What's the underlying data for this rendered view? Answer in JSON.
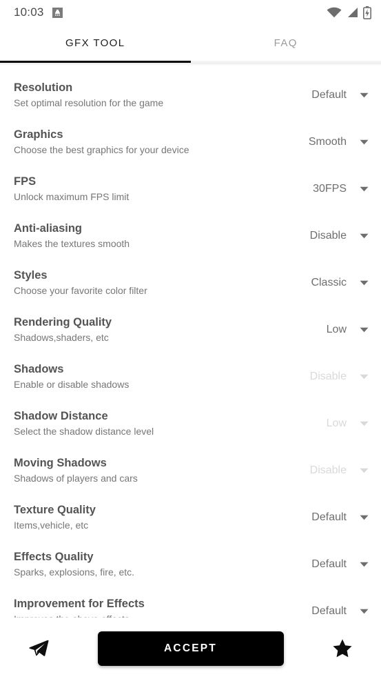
{
  "statusbar": {
    "time": "10:03",
    "notification_icon": "app-notification-icon",
    "wifi_icon": "wifi-icon",
    "signal_icon": "cellular-signal-icon",
    "battery_icon": "battery-charging-icon"
  },
  "tabs": [
    {
      "label": "GFX TOOL",
      "active": true
    },
    {
      "label": "FAQ",
      "active": false
    }
  ],
  "settings": [
    {
      "title": "Resolution",
      "subtitle": "Set optimal resolution for the game",
      "value": "Default",
      "disabled": false
    },
    {
      "title": "Graphics",
      "subtitle": "Choose the best graphics for your device",
      "value": "Smooth",
      "disabled": false
    },
    {
      "title": "FPS",
      "subtitle": "Unlock maximum FPS limit",
      "value": "30FPS",
      "disabled": false
    },
    {
      "title": "Anti-aliasing",
      "subtitle": "Makes the textures smooth",
      "value": "Disable",
      "disabled": false
    },
    {
      "title": "Styles",
      "subtitle": "Choose your favorite color filter",
      "value": "Classic",
      "disabled": false
    },
    {
      "title": "Rendering Quality",
      "subtitle": "Shadows,shaders, etc",
      "value": "Low",
      "disabled": false
    },
    {
      "title": "Shadows",
      "subtitle": "Enable or disable shadows",
      "value": "Disable",
      "disabled": true
    },
    {
      "title": "Shadow Distance",
      "subtitle": "Select the shadow distance level",
      "value": "Low",
      "disabled": true
    },
    {
      "title": "Moving Shadows",
      "subtitle": "Shadows of players and cars",
      "value": "Disable",
      "disabled": true
    },
    {
      "title": "Texture Quality",
      "subtitle": "Items,vehicle, etc",
      "value": "Default",
      "disabled": false
    },
    {
      "title": "Effects Quality",
      "subtitle": "Sparks, explosions, fire, etc.",
      "value": "Default",
      "disabled": false
    },
    {
      "title": "Improvement for Effects",
      "subtitle": "Improves the above effects",
      "value": "Default",
      "disabled": false
    }
  ],
  "bottombar": {
    "send_icon": "paper-plane-icon",
    "accept_label": "ACCEPT",
    "favorite_icon": "star-icon"
  },
  "colors": {
    "accent": "#000000",
    "title": "#545454",
    "subtitle": "#767676",
    "value": "#6e6e6e",
    "value_disabled": "#d9d9d9",
    "tab_active": "#1c1c1c",
    "tab_inactive": "#9a9a9a"
  }
}
